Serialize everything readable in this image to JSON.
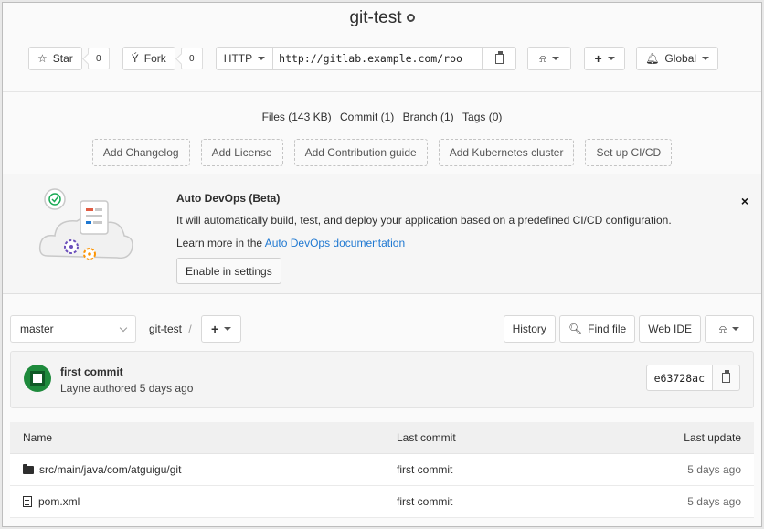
{
  "project": {
    "title": "git-test",
    "visibility_icon": "globe-icon"
  },
  "controls": {
    "star_label": "Star",
    "star_count": "0",
    "fork_label": "Fork",
    "fork_count": "0",
    "clone_protocol": "HTTP",
    "clone_url": "http://gitlab.example.com/roo",
    "notification_label": "Global"
  },
  "stats": {
    "files": "Files (143 KB)",
    "commits": "Commit (1)",
    "branches": "Branch (1)",
    "tags": "Tags (0)"
  },
  "quick_links": [
    "Add Changelog",
    "Add License",
    "Add Contribution guide",
    "Add Kubernetes cluster",
    "Set up CI/CD"
  ],
  "devops": {
    "title": "Auto DevOps (Beta)",
    "description": "It will automatically build, test, and deploy your application based on a predefined CI/CD configuration.",
    "learn_prefix": "Learn more in the",
    "learn_link": "Auto DevOps documentation",
    "enable_button": "Enable in settings",
    "dismiss": "×"
  },
  "tree": {
    "branch": "master",
    "breadcrumb": "git-test",
    "breadcrumb_sep": "/",
    "history": "History",
    "find_file": "Find file",
    "web_ide": "Web IDE"
  },
  "commit": {
    "title": "first commit",
    "meta": "Layne authored 5 days ago",
    "sha": "e63728ac"
  },
  "table": {
    "headers": {
      "name": "Name",
      "last_commit": "Last commit",
      "last_update": "Last update"
    },
    "rows": [
      {
        "name": "src/main/java/com/atguigu/git",
        "type": "folder",
        "commit": "first commit",
        "updated": "5 days ago"
      },
      {
        "name": "pom.xml",
        "type": "file",
        "commit": "first commit",
        "updated": "5 days ago"
      }
    ]
  },
  "colors": {
    "link": "#1f78d1",
    "avatar": "#1e8a3c"
  }
}
